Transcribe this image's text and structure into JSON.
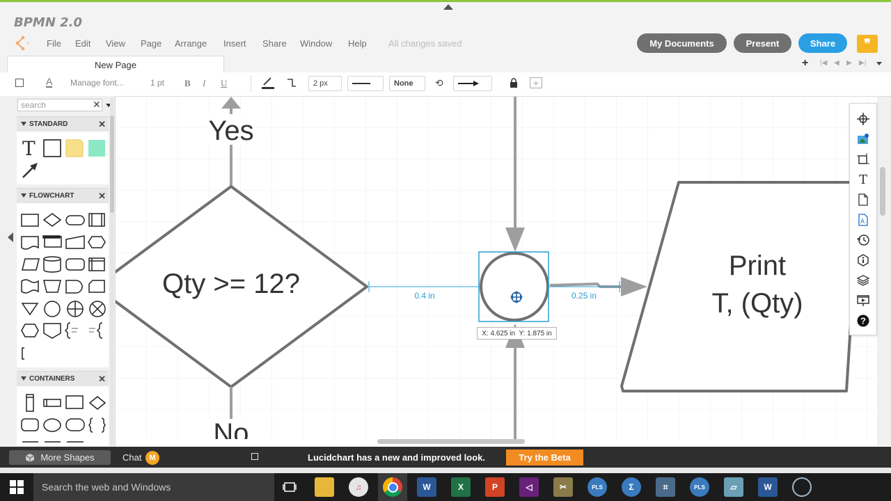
{
  "app": {
    "title": "BPMN 2.0",
    "status": "All changes saved"
  },
  "menu": [
    "File",
    "Edit",
    "View",
    "Page",
    "Arrange",
    "Insert",
    "Share",
    "Window",
    "Help"
  ],
  "header_buttons": {
    "my_documents": "My Documents",
    "present": "Present",
    "share": "Share",
    "feedback_glyph": "❞"
  },
  "tabs": [
    {
      "label": "New Page"
    }
  ],
  "toolbar": {
    "font_placeholder": "Manage font...",
    "font_size": "1 pt",
    "bold": "B",
    "italic": "I",
    "underline": "U",
    "line_width": "2 px",
    "line_end": "None"
  },
  "left_panel": {
    "search_placeholder": "search",
    "sections": [
      {
        "title": "STANDARD"
      },
      {
        "title": "FLOWCHART"
      },
      {
        "title": "CONTAINERS"
      }
    ],
    "more_shapes": "More Shapes"
  },
  "canvas": {
    "labels": {
      "yes": "Yes",
      "no": "No",
      "decision": "Qty >= 12?",
      "print_line1": "Print",
      "print_line2": "T, (Qty)"
    },
    "measure_left": "0.4 in",
    "measure_right": "0.25 in",
    "coords": "X: 4.625 in  Y: 1.875 in",
    "colors": {
      "shape_stroke": "#707070",
      "selection": "#2a9fd4",
      "arrow": "#9e9e9e"
    }
  },
  "bottom_bar": {
    "chat": "Chat",
    "chat_avatar": "M",
    "message": "Lucidchart has a new and improved look.",
    "beta_button": "Try the Beta"
  },
  "taskbar": {
    "search_placeholder": "Search the web and Windows"
  }
}
